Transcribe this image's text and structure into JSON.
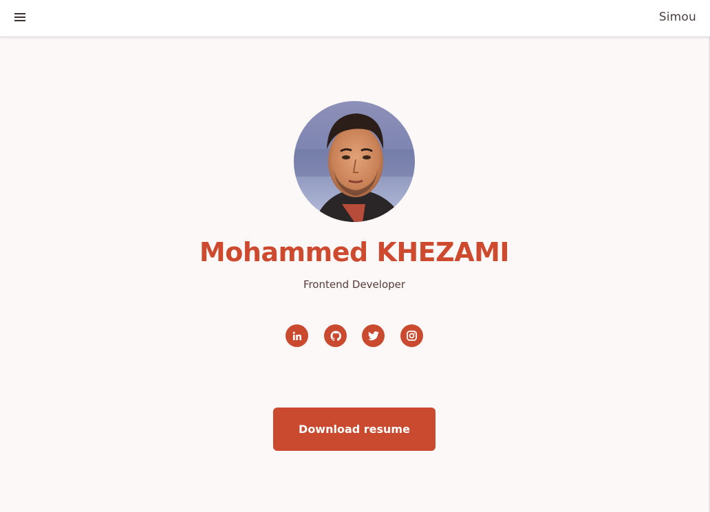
{
  "header": {
    "menu_icon": "hamburger-menu-icon",
    "brand": "Simou"
  },
  "profile": {
    "avatar_icon": "profile-photo",
    "name": "Mohammed KHEZAMI",
    "role": "Frontend Developer"
  },
  "social": [
    {
      "icon": "linkedin-icon"
    },
    {
      "icon": "github-icon"
    },
    {
      "icon": "twitter-icon"
    },
    {
      "icon": "instagram-icon"
    }
  ],
  "actions": {
    "download_label": "Download resume"
  },
  "colors": {
    "accent": "#cd4a2f",
    "background": "#fdf8f8",
    "header": "#ffffff",
    "text_dark": "#553a3a"
  }
}
